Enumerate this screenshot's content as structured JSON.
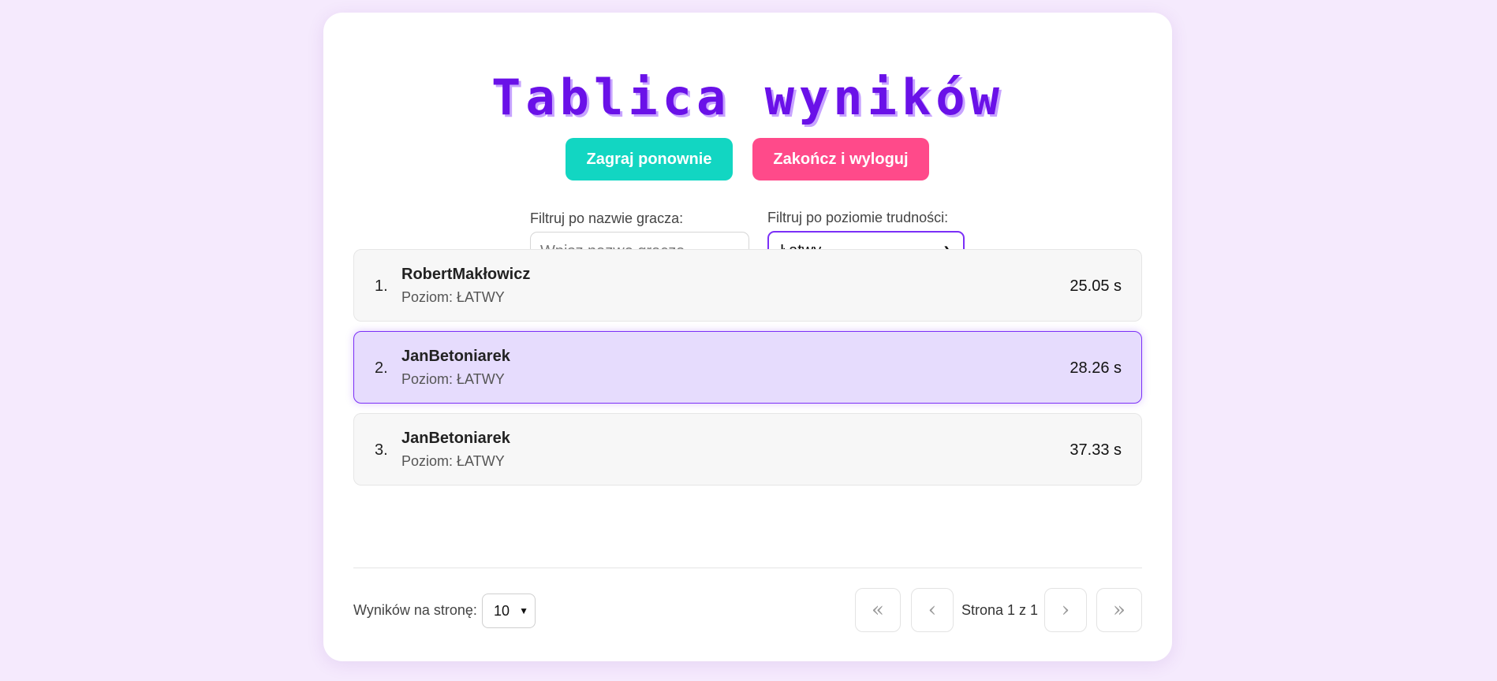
{
  "title": "Tablica wyników",
  "buttons": {
    "replay": "Zagraj ponownie",
    "logout": "Zakończ i wyloguj"
  },
  "filters": {
    "name_label": "Filtruj po nazwie gracza:",
    "name_placeholder": "Wpisz nazwę gracza...",
    "name_value": "",
    "level_label": "Filtruj po poziomie trudności:",
    "level_selected": "Łatwy"
  },
  "results": [
    {
      "rank": "1.",
      "name": "RobertMakłowicz",
      "level": "Poziom: ŁATWY",
      "time": "25.05 s",
      "highlighted": false
    },
    {
      "rank": "2.",
      "name": "JanBetoniarek",
      "level": "Poziom: ŁATWY",
      "time": "28.26 s",
      "highlighted": true
    },
    {
      "rank": "3.",
      "name": "JanBetoniarek",
      "level": "Poziom: ŁATWY",
      "time": "37.33 s",
      "highlighted": false
    }
  ],
  "pagination": {
    "per_page_label": "Wyników na stronę:",
    "per_page_value": "10",
    "first": "«",
    "prev": "‹",
    "next": "›",
    "last": "»",
    "page_info": "Strona 1 z 1"
  },
  "colors": {
    "accent": "#6a11e8",
    "replay": "#12d6c2",
    "logout": "#ff4a8a",
    "highlight_bg": "#e6dcfd",
    "background": "#f5eafd"
  }
}
